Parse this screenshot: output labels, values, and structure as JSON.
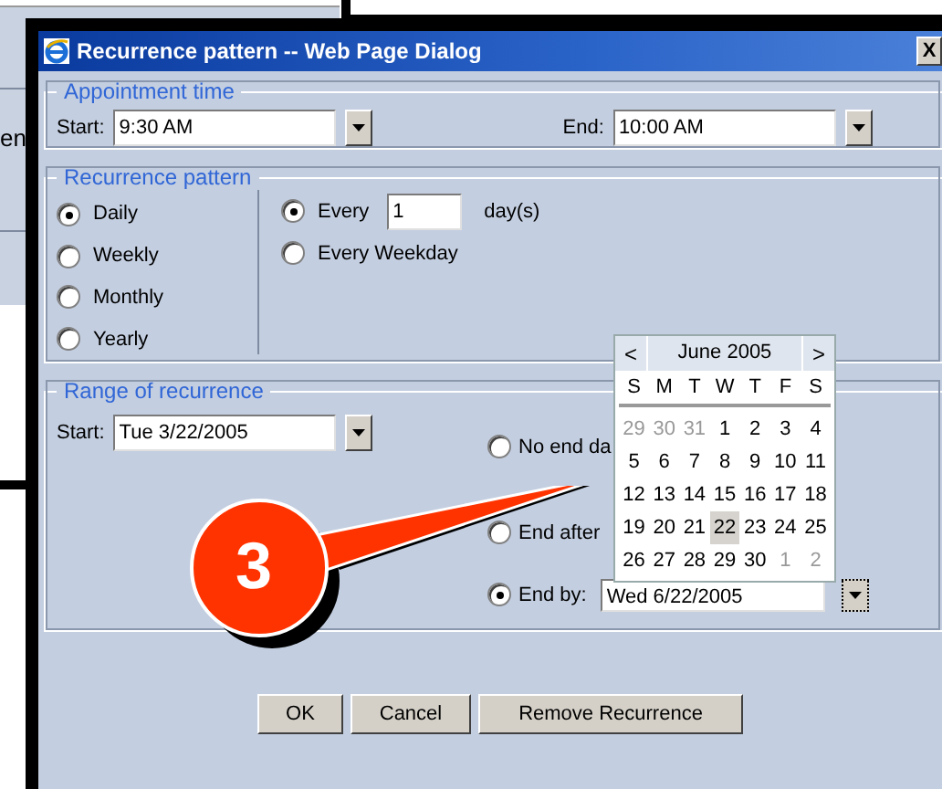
{
  "window": {
    "title": "Recurrence pattern -- Web Page Dialog",
    "close": "X"
  },
  "background_window": {
    "text": "en"
  },
  "appointment_time": {
    "legend": "Appointment time",
    "start_label": "Start:",
    "start": "9:30 AM",
    "end_label": "End:",
    "end": "10:00 AM"
  },
  "recurrence_pattern": {
    "legend": "Recurrence pattern",
    "frequencies": [
      {
        "label": "Daily",
        "selected": true
      },
      {
        "label": "Weekly",
        "selected": false
      },
      {
        "label": "Monthly",
        "selected": false
      },
      {
        "label": "Yearly",
        "selected": false
      }
    ],
    "daily_options": [
      {
        "kind": "interval",
        "label": "Every",
        "value": "1",
        "unit": "day(s)",
        "selected": true
      },
      {
        "kind": "plain",
        "label": "Every Weekday",
        "selected": false
      }
    ]
  },
  "range": {
    "legend": "Range of recurrence",
    "start_label": "Start:",
    "start": "Tue 3/22/2005",
    "end_options": [
      {
        "kind": "plain",
        "label": "No end da",
        "selected": false
      },
      {
        "kind": "plain",
        "label": "End after",
        "selected": false
      },
      {
        "kind": "date",
        "label": "End by:",
        "value": "Wed 6/22/2005",
        "selected": true
      }
    ]
  },
  "calendar": {
    "prev": "<",
    "month": "June 2005",
    "next": ">",
    "weekdays": [
      "S",
      "M",
      "T",
      "W",
      "T",
      "F",
      "S"
    ],
    "weeks": [
      [
        {
          "day": "29",
          "other_month": true,
          "selected": false
        },
        {
          "day": "30",
          "other_month": true,
          "selected": false
        },
        {
          "day": "31",
          "other_month": true,
          "selected": false
        },
        {
          "day": "1",
          "other_month": false,
          "selected": false
        },
        {
          "day": "2",
          "other_month": false,
          "selected": false
        },
        {
          "day": "3",
          "other_month": false,
          "selected": false
        },
        {
          "day": "4",
          "other_month": false,
          "selected": false
        }
      ],
      [
        {
          "day": "5",
          "other_month": false,
          "selected": false
        },
        {
          "day": "6",
          "other_month": false,
          "selected": false
        },
        {
          "day": "7",
          "other_month": false,
          "selected": false
        },
        {
          "day": "8",
          "other_month": false,
          "selected": false
        },
        {
          "day": "9",
          "other_month": false,
          "selected": false
        },
        {
          "day": "10",
          "other_month": false,
          "selected": false
        },
        {
          "day": "11",
          "other_month": false,
          "selected": false
        }
      ],
      [
        {
          "day": "12",
          "other_month": false,
          "selected": false
        },
        {
          "day": "13",
          "other_month": false,
          "selected": false
        },
        {
          "day": "14",
          "other_month": false,
          "selected": false
        },
        {
          "day": "15",
          "other_month": false,
          "selected": false
        },
        {
          "day": "16",
          "other_month": false,
          "selected": false
        },
        {
          "day": "17",
          "other_month": false,
          "selected": false
        },
        {
          "day": "18",
          "other_month": false,
          "selected": false
        }
      ],
      [
        {
          "day": "19",
          "other_month": false,
          "selected": false
        },
        {
          "day": "20",
          "other_month": false,
          "selected": false
        },
        {
          "day": "21",
          "other_month": false,
          "selected": false
        },
        {
          "day": "22",
          "other_month": false,
          "selected": true
        },
        {
          "day": "23",
          "other_month": false,
          "selected": false
        },
        {
          "day": "24",
          "other_month": false,
          "selected": false
        },
        {
          "day": "25",
          "other_month": false,
          "selected": false
        }
      ],
      [
        {
          "day": "26",
          "other_month": false,
          "selected": false
        },
        {
          "day": "27",
          "other_month": false,
          "selected": false
        },
        {
          "day": "28",
          "other_month": false,
          "selected": false
        },
        {
          "day": "29",
          "other_month": false,
          "selected": false
        },
        {
          "day": "30",
          "other_month": false,
          "selected": false
        },
        {
          "day": "1",
          "other_month": true,
          "selected": false
        },
        {
          "day": "2",
          "other_month": true,
          "selected": false
        }
      ]
    ]
  },
  "buttons": [
    "OK",
    "Cancel",
    "Remove Recurrence"
  ],
  "callout": {
    "number": "3"
  }
}
